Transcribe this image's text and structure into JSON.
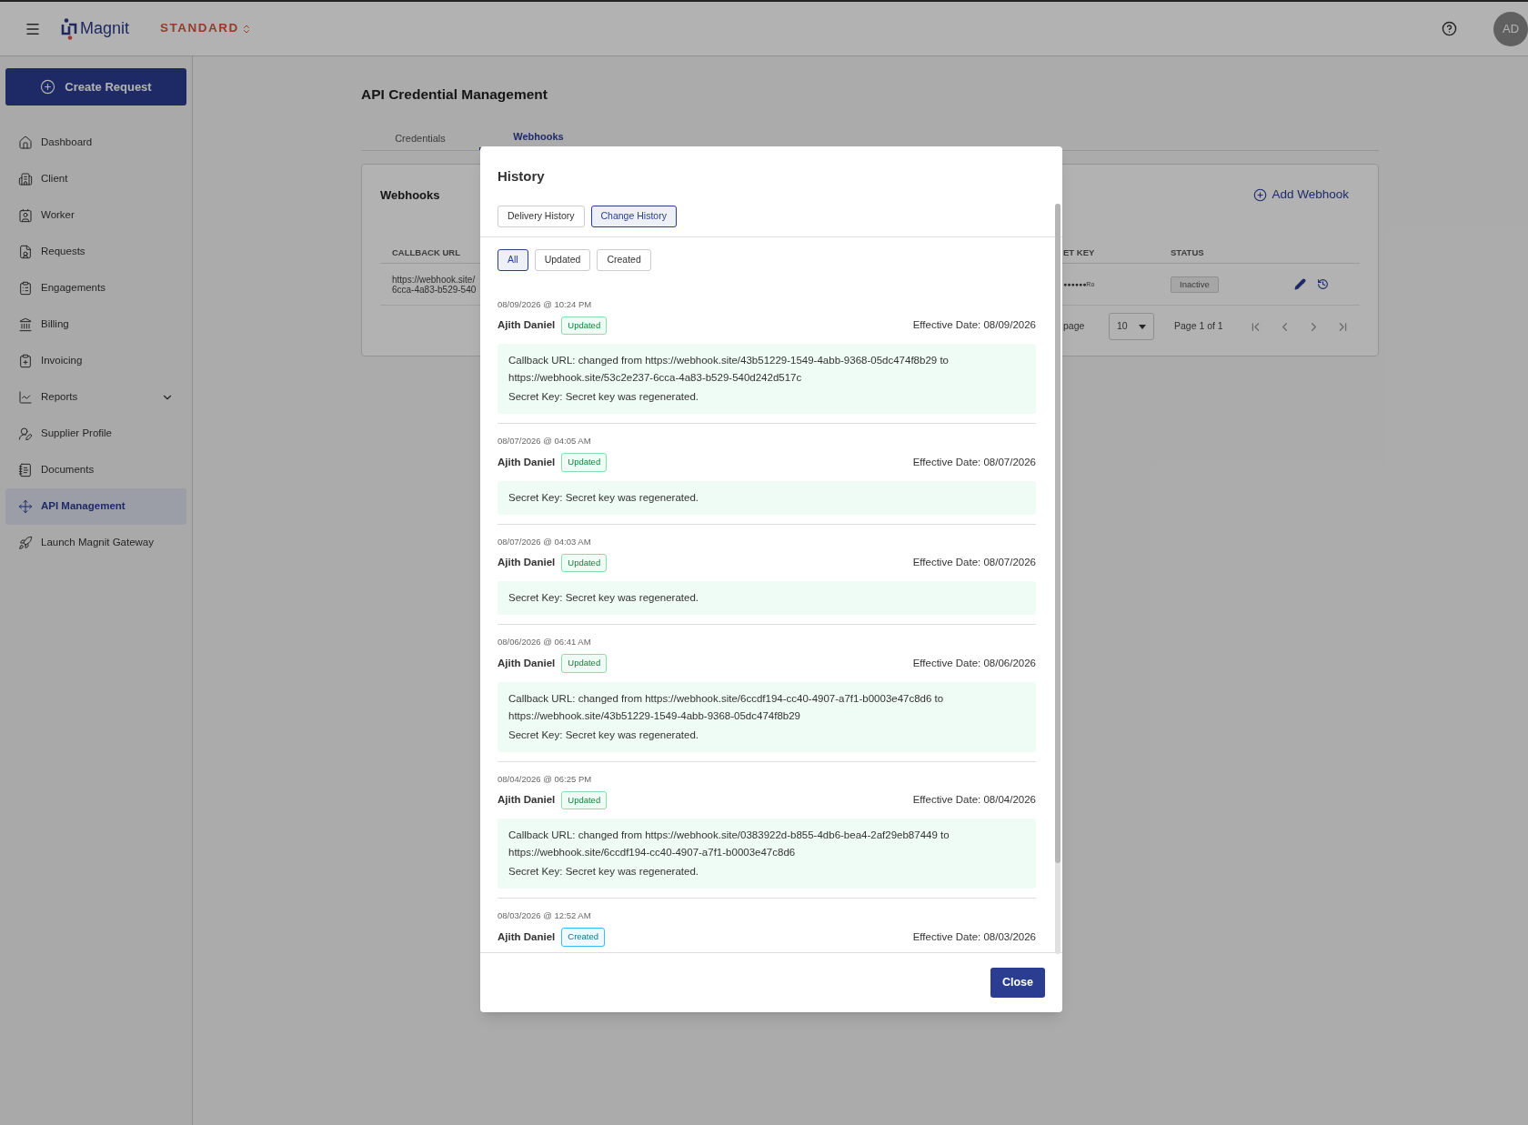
{
  "top_bar": {
    "brand": "Magnit",
    "plan": "STANDARD",
    "avatar": "AD"
  },
  "sidebar": {
    "create_button": "Create Request",
    "items": [
      {
        "label": "Dashboard",
        "selected": false
      },
      {
        "label": "Client",
        "selected": false
      },
      {
        "label": "Worker",
        "selected": false
      },
      {
        "label": "Requests",
        "selected": false
      },
      {
        "label": "Engagements",
        "selected": false
      },
      {
        "label": "Billing",
        "selected": false
      },
      {
        "label": "Invoicing",
        "selected": false
      },
      {
        "label": "Reports",
        "selected": false,
        "expanded": false
      },
      {
        "label": "Supplier Profile",
        "selected": false
      },
      {
        "label": "Documents",
        "selected": false
      },
      {
        "label": "API Management",
        "selected": true
      },
      {
        "label": "Launch Magnit Gateway",
        "selected": false
      }
    ]
  },
  "page": {
    "title": "API Credential Management",
    "tabs": [
      {
        "label": "Credentials",
        "selected": false
      },
      {
        "label": "Webhooks",
        "selected": true
      }
    ],
    "card": {
      "title": "Webhooks",
      "add_button": "Add Webhook",
      "columns": [
        "CALLBACK URL",
        "ET KEY",
        "STATUS"
      ],
      "row": {
        "callback_url_lines": [
          "https://webhook.site/",
          "6cca-4a83-b529-540"
        ],
        "secret_key": "●●●●●●Ro",
        "status": "Inactive"
      },
      "pagination": {
        "rows_label": "page",
        "rows_value": "10",
        "page_info": "Page 1 of 1"
      }
    }
  },
  "modal": {
    "title": "History",
    "tabs": [
      {
        "label": "Delivery History",
        "selected": false
      },
      {
        "label": "Change History",
        "selected": true
      }
    ],
    "filters": [
      {
        "label": "All",
        "selected": true
      },
      {
        "label": "Updated",
        "selected": false
      },
      {
        "label": "Created",
        "selected": false
      }
    ],
    "entries": [
      {
        "timestamp": "08/09/2026 @ 10:24 PM",
        "user": "Ajith Daniel",
        "kind": "updated",
        "status": "Updated",
        "effective_date": "Effective Date: 08/09/2026",
        "changes": [
          "Callback URL: changed from https://webhook.site/43b51229-1549-4abb-9368-05dc474f8b29 to https://webhook.site/53c2e237-6cca-4a83-b529-540d242d517c",
          "Secret Key: Secret key was regenerated."
        ]
      },
      {
        "timestamp": "08/07/2026 @ 04:05 AM",
        "user": "Ajith Daniel",
        "kind": "updated",
        "status": "Updated",
        "effective_date": "Effective Date: 08/07/2026",
        "changes": [
          "Secret Key: Secret key was regenerated."
        ]
      },
      {
        "timestamp": "08/07/2026 @ 04:03 AM",
        "user": "Ajith Daniel",
        "kind": "updated",
        "status": "Updated",
        "effective_date": "Effective Date: 08/07/2026",
        "changes": [
          "Secret Key: Secret key was regenerated."
        ]
      },
      {
        "timestamp": "08/06/2026 @ 06:41 AM",
        "user": "Ajith Daniel",
        "kind": "updated",
        "status": "Updated",
        "effective_date": "Effective Date: 08/06/2026",
        "changes": [
          "Callback URL: changed from https://webhook.site/6ccdf194-cc40-4907-a7f1-b0003e47c8d6 to https://webhook.site/43b51229-1549-4abb-9368-05dc474f8b29",
          "Secret Key: Secret key was regenerated."
        ]
      },
      {
        "timestamp": "08/04/2026 @ 06:25 PM",
        "user": "Ajith Daniel",
        "kind": "updated",
        "status": "Updated",
        "effective_date": "Effective Date: 08/04/2026",
        "changes": [
          "Callback URL: changed from https://webhook.site/0383922d-b855-4db6-bea4-2af29eb87449 to https://webhook.site/6ccdf194-cc40-4907-a7f1-b0003e47c8d6",
          "Secret Key: Secret key was regenerated."
        ]
      },
      {
        "timestamp": "08/03/2026 @ 12:52 AM",
        "user": "Ajith Daniel",
        "kind": "created",
        "status": "Created",
        "effective_date": "Effective Date: 08/03/2026"
      }
    ],
    "close_button": "Close"
  }
}
